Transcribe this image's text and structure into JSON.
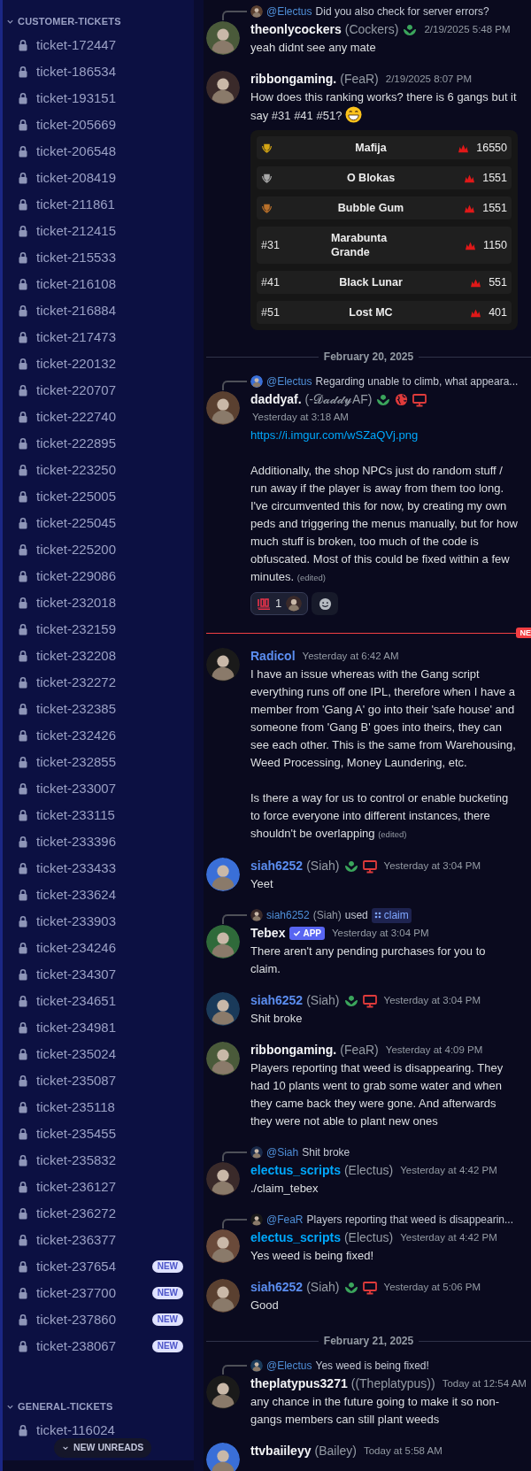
{
  "sidebar": {
    "categories": [
      {
        "label": "CUSTOMER-TICKETS",
        "expanded": true,
        "channels": [
          {
            "name": "ticket-172447"
          },
          {
            "name": "ticket-186534"
          },
          {
            "name": "ticket-193151"
          },
          {
            "name": "ticket-205669"
          },
          {
            "name": "ticket-206548"
          },
          {
            "name": "ticket-208419"
          },
          {
            "name": "ticket-211861"
          },
          {
            "name": "ticket-212415"
          },
          {
            "name": "ticket-215533"
          },
          {
            "name": "ticket-216108"
          },
          {
            "name": "ticket-216884"
          },
          {
            "name": "ticket-217473"
          },
          {
            "name": "ticket-220132"
          },
          {
            "name": "ticket-220707"
          },
          {
            "name": "ticket-222740"
          },
          {
            "name": "ticket-222895"
          },
          {
            "name": "ticket-223250"
          },
          {
            "name": "ticket-225005"
          },
          {
            "name": "ticket-225045"
          },
          {
            "name": "ticket-225200"
          },
          {
            "name": "ticket-229086"
          },
          {
            "name": "ticket-232018"
          },
          {
            "name": "ticket-232159"
          },
          {
            "name": "ticket-232208"
          },
          {
            "name": "ticket-232272"
          },
          {
            "name": "ticket-232385"
          },
          {
            "name": "ticket-232426"
          },
          {
            "name": "ticket-232855"
          },
          {
            "name": "ticket-233007"
          },
          {
            "name": "ticket-233115"
          },
          {
            "name": "ticket-233396"
          },
          {
            "name": "ticket-233433"
          },
          {
            "name": "ticket-233624"
          },
          {
            "name": "ticket-233903"
          },
          {
            "name": "ticket-234246"
          },
          {
            "name": "ticket-234307"
          },
          {
            "name": "ticket-234651"
          },
          {
            "name": "ticket-234981"
          },
          {
            "name": "ticket-235024"
          },
          {
            "name": "ticket-235087"
          },
          {
            "name": "ticket-235118"
          },
          {
            "name": "ticket-235455"
          },
          {
            "name": "ticket-235832"
          },
          {
            "name": "ticket-236127"
          },
          {
            "name": "ticket-236272"
          },
          {
            "name": "ticket-236377"
          },
          {
            "name": "ticket-237654",
            "badge": "NEW"
          },
          {
            "name": "ticket-237700",
            "badge": "NEW"
          },
          {
            "name": "ticket-237860",
            "badge": "NEW"
          },
          {
            "name": "ticket-238067",
            "badge": "NEW"
          }
        ]
      },
      {
        "label": "GENERAL-TICKETS",
        "expanded": true,
        "channels": [
          {
            "name": "ticket-116024"
          }
        ]
      }
    ],
    "new_unreads": "NEW UNREADS"
  },
  "messages": [
    {
      "kind": "message",
      "reply": {
        "kind": "mention",
        "mention": "@Electus",
        "text": "Did you also check for server errors?"
      },
      "author": {
        "name": "theonlycockers",
        "nick": "(Cockers)",
        "color": "#f2f3f5"
      },
      "badges": [
        {
          "kind": "guild"
        }
      ],
      "timestamp": "2/19/2025 5:48 PM",
      "timestamp_below": false,
      "body": [
        {
          "kind": "text",
          "text": "yeah didnt see any mate"
        }
      ]
    },
    {
      "kind": "message",
      "author": {
        "name": "ribbongaming.",
        "nick": "(FeaR)",
        "color": "#f2f3f5"
      },
      "timestamp": "2/19/2025 8:07 PM",
      "timestamp_below": false,
      "body": [
        {
          "kind": "text_with_emoji",
          "text": "How does this ranking works? there is 6 gangs but it say #31 #41 #51?"
        }
      ],
      "ranking": [
        {
          "kind": "trophy",
          "color": "#d4a514",
          "name": "Mafija",
          "score": "16550"
        },
        {
          "kind": "trophy",
          "color": "#a8a8a8",
          "name": "O Blokas",
          "score": "1551"
        },
        {
          "kind": "trophy",
          "color": "#b8702a",
          "name": "Bubble Gum",
          "score": "1551"
        },
        {
          "kind": "text",
          "rank": "#31",
          "name": "Marabunta Grande",
          "score": "1150"
        },
        {
          "kind": "text",
          "rank": "#41",
          "name": "Black Lunar",
          "score": "551"
        },
        {
          "kind": "text",
          "rank": "#51",
          "name": "Lost MC",
          "score": "401"
        }
      ]
    },
    {
      "kind": "date_divider",
      "label": "February 20, 2025"
    },
    {
      "kind": "message",
      "reply": {
        "kind": "mention",
        "mention": "@Electus",
        "text": "Regarding unable to climb, what appeara..."
      },
      "author": {
        "name": "daddyaf.",
        "nick": "(-𝓓𝓪𝓭𝓭𝔂AF)",
        "color": "#f2f3f5"
      },
      "badges": [
        {
          "kind": "guild"
        },
        {
          "kind": "globe"
        },
        {
          "kind": "monitor"
        }
      ],
      "timestamp": "Yesterday at 3:18 AM",
      "timestamp_below": true,
      "body": [
        {
          "kind": "link",
          "text": "https://i.imgur.com/wSZaQVj.png"
        },
        {
          "kind": "text",
          "text": "Additionally, the shop NPCs just do random stuff / run away if the player is away from them too long. I've circumvented this for now, by creating my own peds and triggering the menus manually, but for how much stuff is broken, too much of the code is obfuscated. Most of this could be fixed within a few minutes."
        }
      ],
      "edited": "(edited)",
      "reactions": [
        {
          "kind": "hundred",
          "count": "1"
        },
        {
          "kind": "add"
        }
      ]
    },
    {
      "kind": "new_divider",
      "label": "NE"
    },
    {
      "kind": "message",
      "author": {
        "name": "Radicol",
        "color": "#5b8def"
      },
      "timestamp": "Yesterday at 6:42 AM",
      "timestamp_below": false,
      "body": [
        {
          "kind": "text",
          "text": "I have an issue whereas with the Gang script everything runs off one IPL, therefore when I have a member from 'Gang A' go into their 'safe house'  and someone from 'Gang B' goes into theirs, they can see each other. This is the same from Warehousing, Weed Processing, Money Laundering, etc."
        },
        {
          "kind": "text",
          "text": "Is there a way for us to control or enable bucketing to force everyone into different instances, there shouldn't be overlapping"
        }
      ],
      "edited": "(edited)"
    },
    {
      "kind": "message",
      "author": {
        "name": "siah6252",
        "nick": "(Siah)",
        "color": "#5b8def"
      },
      "badges": [
        {
          "kind": "guild"
        },
        {
          "kind": "monitor"
        }
      ],
      "timestamp": "Yesterday at 3:04 PM",
      "timestamp_below": false,
      "body": [
        {
          "kind": "text",
          "text": "Yeet"
        }
      ]
    },
    {
      "kind": "message",
      "reply": {
        "kind": "command",
        "user": "siah6252",
        "nick": "(Siah)",
        "verb": "used",
        "command": "claim"
      },
      "author": {
        "name": "Tebex",
        "color": "#f2f3f5",
        "tag": "APP"
      },
      "timestamp": "Yesterday at 3:04 PM",
      "timestamp_below": false,
      "body": [
        {
          "kind": "text",
          "text": "There aren't any pending purchases for you to claim."
        }
      ]
    },
    {
      "kind": "message",
      "author": {
        "name": "siah6252",
        "nick": "(Siah)",
        "color": "#5b8def"
      },
      "badges": [
        {
          "kind": "guild"
        },
        {
          "kind": "monitor"
        }
      ],
      "timestamp": "Yesterday at 3:04 PM",
      "timestamp_below": false,
      "body": [
        {
          "kind": "text",
          "text": "Shit broke"
        }
      ]
    },
    {
      "kind": "message",
      "author": {
        "name": "ribbongaming.",
        "nick": "(FeaR)",
        "color": "#f2f3f5"
      },
      "timestamp": "Yesterday at 4:09 PM",
      "timestamp_below": false,
      "body": [
        {
          "kind": "text",
          "text": "Players reporting that weed is disappearing. They had 10 plants went to grab some water and when they came back they were gone. And afterwards they were not able to plant new ones"
        }
      ]
    },
    {
      "kind": "message",
      "reply": {
        "kind": "mention",
        "mention": "@Siah",
        "text": "Shit broke"
      },
      "author": {
        "name": "electus_scripts",
        "nick": "(Electus)",
        "color": "#00a8fc"
      },
      "timestamp": "Yesterday at 4:42 PM",
      "timestamp_below": false,
      "body": [
        {
          "kind": "text",
          "text": "./claim_tebex"
        }
      ]
    },
    {
      "kind": "message",
      "reply": {
        "kind": "mention",
        "mention": "@FeaR",
        "text": "Players reporting that weed is disappearin..."
      },
      "author": {
        "name": "electus_scripts",
        "nick": "(Electus)",
        "color": "#00a8fc"
      },
      "timestamp": "Yesterday at 4:42 PM",
      "timestamp_below": false,
      "body": [
        {
          "kind": "text",
          "text": "Yes weed is being fixed!"
        }
      ]
    },
    {
      "kind": "message",
      "author": {
        "name": "siah6252",
        "nick": "(Siah)",
        "color": "#5b8def"
      },
      "badges": [
        {
          "kind": "guild"
        },
        {
          "kind": "monitor"
        }
      ],
      "timestamp": "Yesterday at 5:06 PM",
      "timestamp_below": false,
      "body": [
        {
          "kind": "text",
          "text": "Good"
        }
      ]
    },
    {
      "kind": "date_divider",
      "label": "February 21, 2025"
    },
    {
      "kind": "message",
      "reply": {
        "kind": "mention",
        "mention": "@Electus",
        "text": "Yes weed is being fixed!"
      },
      "author": {
        "name": "theplatypus3271",
        "nick": "((Theplatypus))",
        "color": "#f2f3f5"
      },
      "timestamp": "Today at 12:54 AM",
      "timestamp_below": false,
      "body": [
        {
          "kind": "text",
          "text": "any chance in the future going to make it so non-gangs members can still plant weeds"
        }
      ]
    },
    {
      "kind": "message",
      "author": {
        "name": "ttvbaiileyy",
        "nick": "(Bailey)",
        "color": "#f2f3f5"
      },
      "timestamp": "Today at 5:58 AM",
      "timestamp_below": false
    }
  ]
}
